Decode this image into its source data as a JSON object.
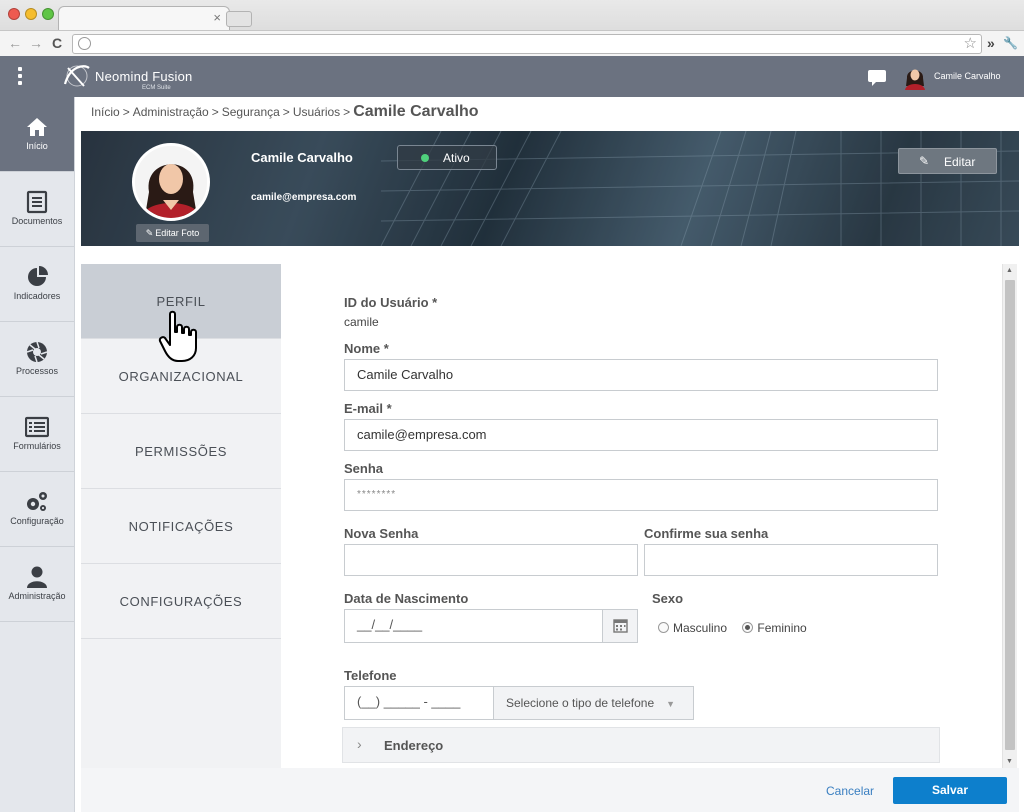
{
  "browser": {
    "tab_close": "×",
    "nav_back": "←",
    "nav_forward": "→",
    "nav_reload": "C",
    "url_star": "☆",
    "menu_more": "»",
    "menu_wrench": "🔧"
  },
  "app": {
    "logo_name": "Neomind Fusion",
    "logo_sub": "ECM Suite",
    "user_name": "Camile Carvalho",
    "accent": "#0d7fcc",
    "header_bg": "#6b7280"
  },
  "sidebar": {
    "items": [
      {
        "label": "Início",
        "icon": "home-icon",
        "active": true
      },
      {
        "label": "Documentos",
        "icon": "document-icon"
      },
      {
        "label": "Indicadores",
        "icon": "pie-chart-icon"
      },
      {
        "label": "Processos",
        "icon": "aperture-icon"
      },
      {
        "label": "Formulários",
        "icon": "form-list-icon"
      },
      {
        "label": "Configuração",
        "icon": "gears-icon"
      },
      {
        "label": "Administração",
        "icon": "user-icon"
      }
    ]
  },
  "breadcrumb": {
    "items": [
      "Início",
      "Administração",
      "Segurança",
      "Usuários"
    ],
    "separator": ">",
    "current": "Camile Carvalho"
  },
  "profile": {
    "name": "Camile Carvalho",
    "email": "camile@empresa.com",
    "status": "Ativo",
    "status_color": "#4fd17c",
    "edit_photo": "Editar Foto",
    "edit_button": "Editar",
    "pencil": "✎"
  },
  "tabs": [
    {
      "label": "PERFIL",
      "active": true
    },
    {
      "label": "ORGANIZACIONAL"
    },
    {
      "label": "PERMISSÕES"
    },
    {
      "label": "NOTIFICAÇÕES"
    },
    {
      "label": "CONFIGURAÇÕES"
    }
  ],
  "form": {
    "user_id_label": "ID do Usuário *",
    "user_id_value": "camile",
    "name_label": "Nome *",
    "name_value": "Camile Carvalho",
    "email_label": "E-mail *",
    "email_value": "camile@empresa.com",
    "password_label": "Senha",
    "password_value": "********",
    "new_password_label": "Nova Senha",
    "confirm_password_label": "Confirme sua senha",
    "birthdate_label": "Data de Nascimento",
    "birthdate_placeholder": "__/__/____",
    "sex_label": "Sexo",
    "sex_options": [
      "Masculino",
      "Feminino"
    ],
    "sex_selected": "Feminino",
    "phone_label": "Telefone",
    "phone_placeholder": "(__) _____ - ____",
    "phone_type_placeholder": "Selecione o tipo de telefone",
    "phone_type_caret": "▼",
    "address_label": "Endereço",
    "address_chevron": "›"
  },
  "footer": {
    "cancel": "Cancelar",
    "save": "Salvar"
  },
  "scroll": {
    "up": "▲",
    "down": "▼"
  }
}
